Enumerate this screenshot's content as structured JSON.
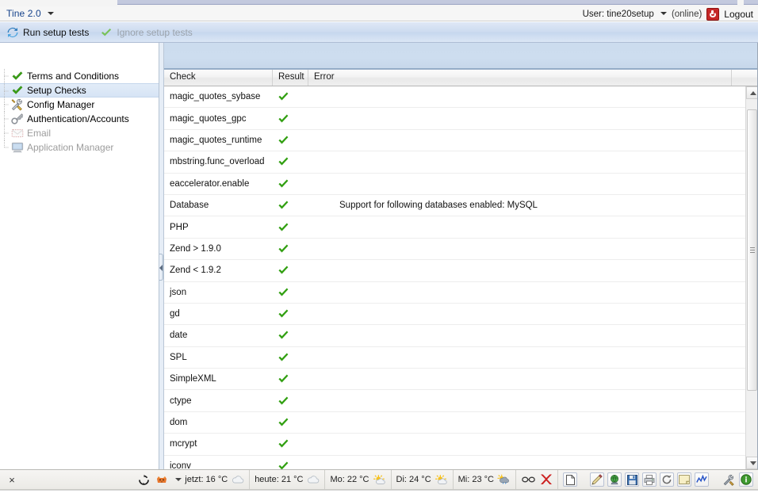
{
  "window": {
    "app_title": "Tine 2.0",
    "user_label": "User: tine20setup",
    "online_label": "(online)",
    "logout_label": "Logout"
  },
  "toolbar": {
    "run_tests_label": "Run setup tests",
    "ignore_tests_label": "Ignore setup tests"
  },
  "sidebar": {
    "items": [
      {
        "label": "Terms and Conditions",
        "icon": "green-check-icon",
        "state": "enabled",
        "selected": false
      },
      {
        "label": "Setup Checks",
        "icon": "green-check-icon",
        "state": "enabled",
        "selected": true
      },
      {
        "label": "Config Manager",
        "icon": "tools-icon",
        "state": "enabled",
        "selected": false
      },
      {
        "label": "Authentication/Accounts",
        "icon": "key-icon",
        "state": "enabled",
        "selected": false
      },
      {
        "label": "Email",
        "icon": "email-icon",
        "state": "disabled",
        "selected": false
      },
      {
        "label": "Application Manager",
        "icon": "monitor-icon",
        "state": "disabled",
        "selected": false
      }
    ]
  },
  "grid": {
    "columns": [
      "Check",
      "Result",
      "Error"
    ],
    "rows": [
      {
        "check": "magic_quotes_sybase",
        "result": "pass",
        "error": ""
      },
      {
        "check": "magic_quotes_gpc",
        "result": "pass",
        "error": ""
      },
      {
        "check": "magic_quotes_runtime",
        "result": "pass",
        "error": ""
      },
      {
        "check": "mbstring.func_overload",
        "result": "pass",
        "error": ""
      },
      {
        "check": "eaccelerator.enable",
        "result": "pass",
        "error": ""
      },
      {
        "check": "Database",
        "result": "pass",
        "error": "Support for following databases enabled: MySQL"
      },
      {
        "check": "PHP",
        "result": "pass",
        "error": ""
      },
      {
        "check": "Zend > 1.9.0",
        "result": "pass",
        "error": ""
      },
      {
        "check": "Zend < 1.9.2",
        "result": "pass",
        "error": ""
      },
      {
        "check": "json",
        "result": "pass",
        "error": ""
      },
      {
        "check": "gd",
        "result": "pass",
        "error": ""
      },
      {
        "check": "date",
        "result": "pass",
        "error": ""
      },
      {
        "check": "SPL",
        "result": "pass",
        "error": ""
      },
      {
        "check": "SimpleXML",
        "result": "pass",
        "error": ""
      },
      {
        "check": "ctype",
        "result": "pass",
        "error": ""
      },
      {
        "check": "dom",
        "result": "pass",
        "error": ""
      },
      {
        "check": "mcrypt",
        "result": "pass",
        "error": ""
      },
      {
        "check": "iconv",
        "result": "pass",
        "error": ""
      }
    ]
  },
  "statusbar": {
    "close_label": "×",
    "weather": [
      {
        "label": "jetzt: 16 °C",
        "icon": "cloud-icon"
      },
      {
        "label": "heute: 21 °C",
        "icon": "cloud-icon"
      },
      {
        "label": "Mo: 22 °C",
        "icon": "sun-cloud-icon"
      },
      {
        "label": "Di: 24 °C",
        "icon": "sun-cloud-icon"
      },
      {
        "label": "Mi: 23 °C",
        "icon": "rain-cloud-icon"
      }
    ],
    "tray_icons": [
      "sync-icon",
      "fox-weather-icon",
      "glasses-icon",
      "red-x-icon",
      "new-document-icon",
      "pencil-icon",
      "web-color-icon",
      "floppy-save-icon",
      "printer-icon",
      "reload-icon",
      "note-icon",
      "chart-icon",
      "tools-icon",
      "info-icon"
    ]
  },
  "colors": {
    "accent_blue": "#15428b",
    "toolbar_blue": "#cddcf0",
    "check_green": "#3aa01a",
    "logout_red": "#c62828",
    "selected_row": "#d6e4f5"
  }
}
